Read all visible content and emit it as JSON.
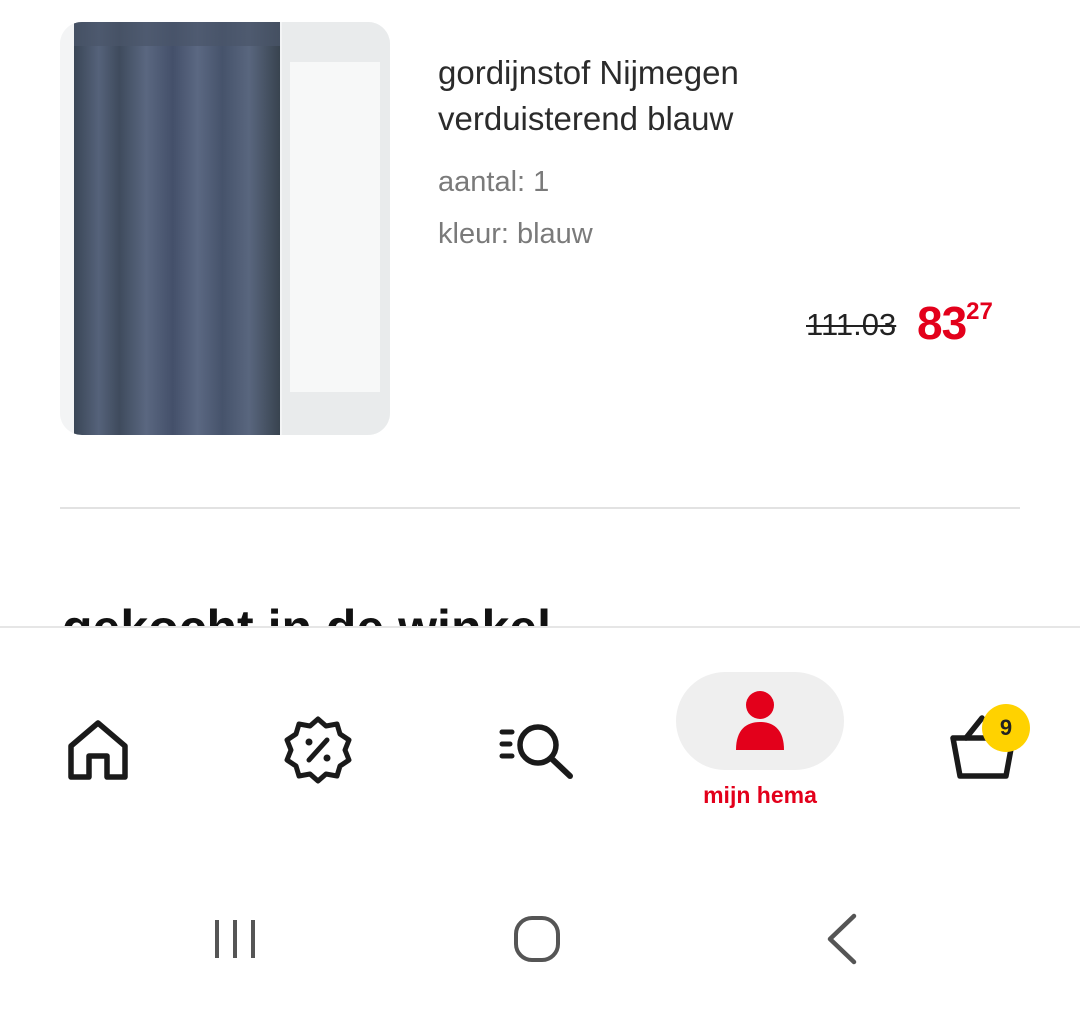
{
  "product": {
    "image_icon": "curtain-photo",
    "title_line1": "gordijnstof Nijmegen",
    "title_line2": "verduisterend blauw",
    "quantity": "aantal: 1",
    "color": "kleur: blauw",
    "old_price": "111.03",
    "new_price_int": "83",
    "new_price_dec": "27",
    "accent_color": "#e3001b"
  },
  "section": {
    "heading": "gekocht in de winkel"
  },
  "bottom_nav": {
    "items": [
      {
        "icon": "home-icon"
      },
      {
        "icon": "discount-icon"
      },
      {
        "icon": "search-list-icon"
      },
      {
        "icon": "user-icon",
        "label": "mijn hema",
        "active": true
      },
      {
        "icon": "basket-icon",
        "badge": "9"
      }
    ],
    "badge_color": "#ffd200"
  },
  "system_nav": {
    "buttons": [
      "recent-apps-icon",
      "home-circle-icon",
      "back-icon"
    ]
  }
}
